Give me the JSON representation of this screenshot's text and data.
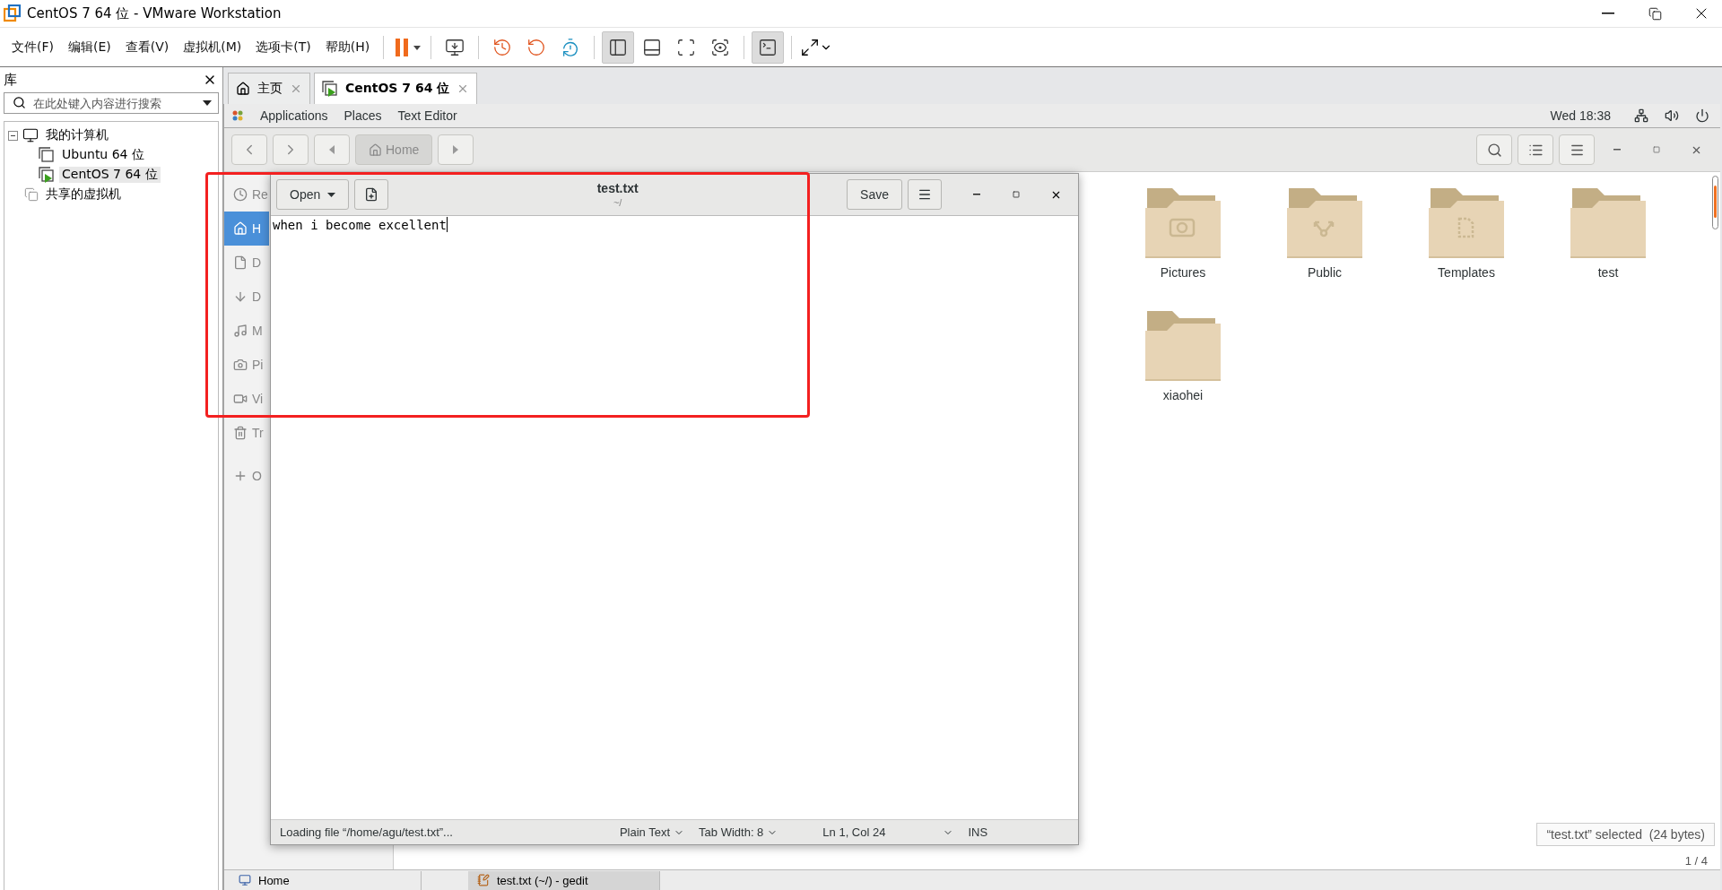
{
  "window": {
    "title": "CentOS 7 64 位 - VMware Workstation"
  },
  "menu": [
    "文件(F)",
    "编辑(E)",
    "查看(V)",
    "虚拟机(M)",
    "选项卡(T)",
    "帮助(H)"
  ],
  "view_buttons": [
    {
      "selected": true
    },
    {
      "selected": false
    },
    {
      "selected": false
    },
    {
      "selected": false
    }
  ],
  "console_button": {
    "selected": true
  },
  "library": {
    "title": "库",
    "search": {
      "placeholder": "在此处键入内容进行搜索"
    },
    "tree": [
      {
        "label": "我的计算机",
        "expanded": true,
        "children": [
          {
            "label": "Ubuntu 64 位",
            "selected": false,
            "running": false
          },
          {
            "label": "CentOS 7 64 位",
            "selected": true,
            "running": true
          }
        ]
      },
      {
        "label": "共享的虚拟机"
      }
    ]
  },
  "tabs": [
    {
      "label": "主页",
      "selected": false
    },
    {
      "label": "CentOS 7 64 位",
      "selected": true
    }
  ],
  "gnome_bar": {
    "menus": [
      "Applications",
      "Places",
      "Text Editor"
    ],
    "clock": "Wed 18:38"
  },
  "files": {
    "path": "Home",
    "sidebar": [
      {
        "kind": "recent",
        "label": "Re",
        "selected": false
      },
      {
        "kind": "home",
        "label": "H",
        "selected": true
      },
      {
        "kind": "documents",
        "label": "D",
        "selected": false
      },
      {
        "kind": "downloads",
        "label": "D",
        "selected": false
      },
      {
        "kind": "music",
        "label": "M",
        "selected": false
      },
      {
        "kind": "pictures",
        "label": "Pi",
        "selected": false
      },
      {
        "kind": "videos",
        "label": "Vi",
        "selected": false
      },
      {
        "kind": "trash",
        "label": "Tr",
        "selected": false
      },
      {
        "kind": "other",
        "label": "O",
        "selected": false
      }
    ],
    "folders": [
      {
        "name": "Pictures",
        "kind": "camera"
      },
      {
        "name": "Public",
        "kind": "share"
      },
      {
        "name": "Templates",
        "kind": "template"
      },
      {
        "name": "test",
        "kind": "plain"
      },
      {
        "name": "xiaohei",
        "kind": "plain"
      }
    ],
    "tooltip": "“test.txt” selected  (24 bytes)",
    "page": "1 / 4"
  },
  "gedit": {
    "open": "Open",
    "title": "test.txt",
    "subtitle": "~/",
    "save": "Save",
    "text": "when i become excellent",
    "status": "Loading file “/home/agu/test.txt”...",
    "language": "Plain Text",
    "tab_width": "Tab Width: 8",
    "position": "Ln 1, Col 24",
    "mode": "INS"
  },
  "taskbar": [
    {
      "label": "Home",
      "selected": false
    },
    {
      "label": "test.txt (~/) - gedit",
      "selected": true
    }
  ]
}
